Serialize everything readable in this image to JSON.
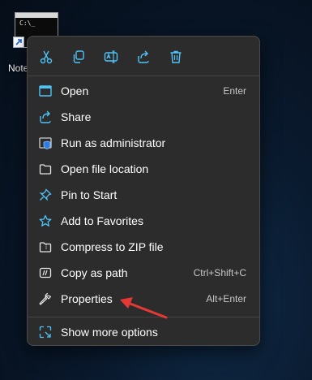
{
  "desktop": {
    "icon_label": "Note",
    "console_text": "C:\\_"
  },
  "menu": {
    "quick_actions": [
      {
        "name": "cut",
        "icon": "scissors-icon"
      },
      {
        "name": "copy",
        "icon": "copy-icon"
      },
      {
        "name": "rename",
        "icon": "rename-icon"
      },
      {
        "name": "share",
        "icon": "share-icon"
      },
      {
        "name": "delete",
        "icon": "trash-icon"
      }
    ],
    "items": [
      {
        "label": "Open",
        "shortcut": "Enter",
        "icon": "open-app-icon"
      },
      {
        "label": "Share",
        "shortcut": "",
        "icon": "share-icon"
      },
      {
        "label": "Run as administrator",
        "shortcut": "",
        "icon": "shield-icon"
      },
      {
        "label": "Open file location",
        "shortcut": "",
        "icon": "folder-icon"
      },
      {
        "label": "Pin to Start",
        "shortcut": "",
        "icon": "pin-icon"
      },
      {
        "label": "Add to Favorites",
        "shortcut": "",
        "icon": "star-icon"
      },
      {
        "label": "Compress to ZIP file",
        "shortcut": "",
        "icon": "zip-folder-icon"
      },
      {
        "label": "Copy as path",
        "shortcut": "Ctrl+Shift+C",
        "icon": "copy-path-icon"
      },
      {
        "label": "Properties",
        "shortcut": "Alt+Enter",
        "icon": "wrench-icon"
      }
    ],
    "more_options": {
      "label": "Show more options",
      "icon": "expand-icon"
    }
  },
  "colors": {
    "accent": "#4fc3f7",
    "menu_bg": "#2c2c2c",
    "annotation_arrow": "#e53935"
  }
}
